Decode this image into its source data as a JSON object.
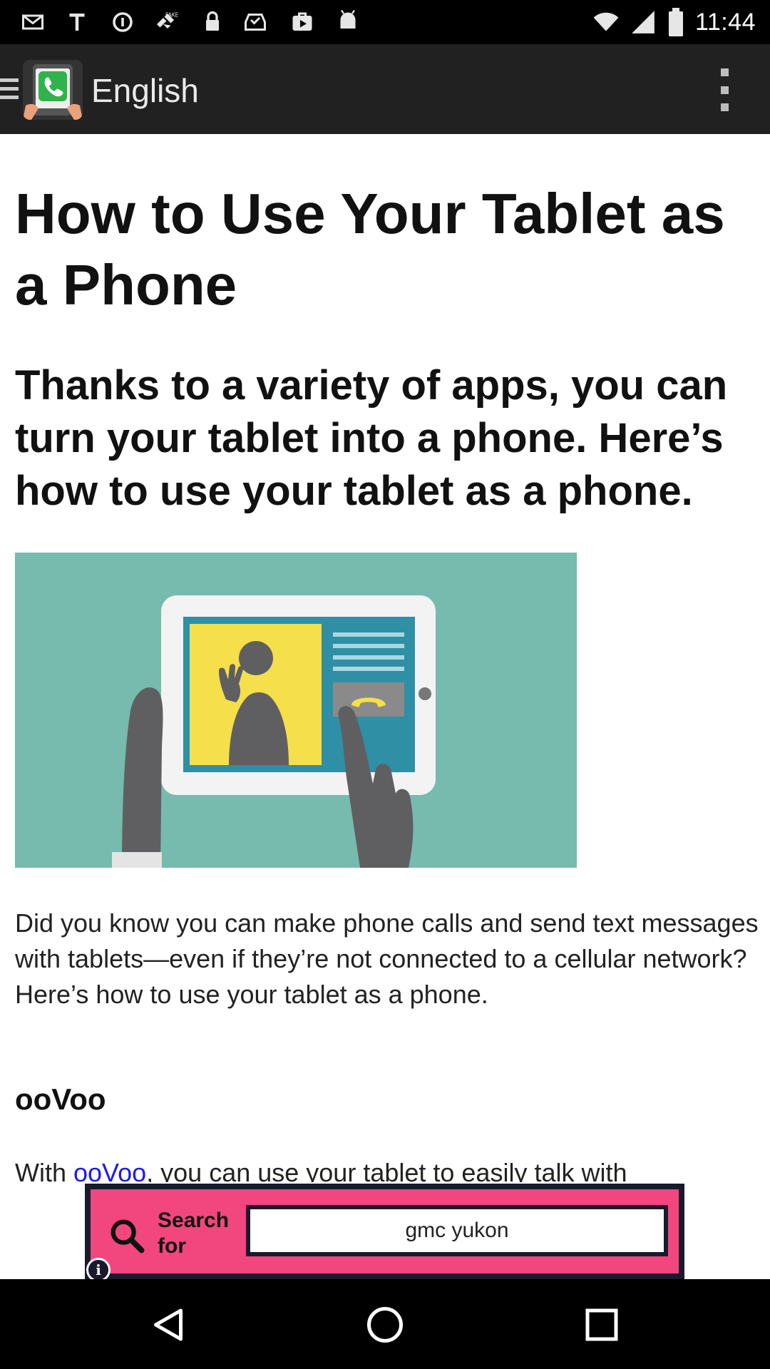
{
  "status_bar": {
    "time": "11:44",
    "icons": [
      "mail-icon",
      "text-t-icon",
      "data-saver-icon",
      "fake-gps-icon",
      "lock-icon",
      "inbox-check-icon",
      "play-store-icon",
      "android-icon",
      "wifi-icon",
      "signal-icon",
      "battery-icon"
    ]
  },
  "app_bar": {
    "title": "English",
    "icons": [
      "menu-icon",
      "app-logo-phone-icon",
      "overflow-menu-icon"
    ]
  },
  "article": {
    "title": "How to Use Your Tablet as a Phone",
    "subtitle": "Thanks to a variety of apps, you can turn your tablet into a phone. Here’s how to use your tablet as a phone.",
    "image_alt": "hand-holding-tablet-video-call-illustration",
    "paragraph1": "Did you know you can make phone calls and send text messages with tablets—even if they’re not connected to a cellular network? Here’s how to use your tablet as a phone.",
    "section_heading": "ooVoo",
    "paragraph2_prefix": "With ",
    "paragraph2_link": "ooVoo",
    "paragraph2_suffix": ", you can use your tablet to easily talk with"
  },
  "ad": {
    "label_line1": "Search",
    "label_line2": "for",
    "query": "gmc yukon",
    "info_label": "i",
    "colors": {
      "background": "#f2467f",
      "border": "#1a1a2e"
    }
  },
  "nav_bar": {
    "icons": [
      "back-icon",
      "home-icon",
      "recents-icon"
    ]
  }
}
